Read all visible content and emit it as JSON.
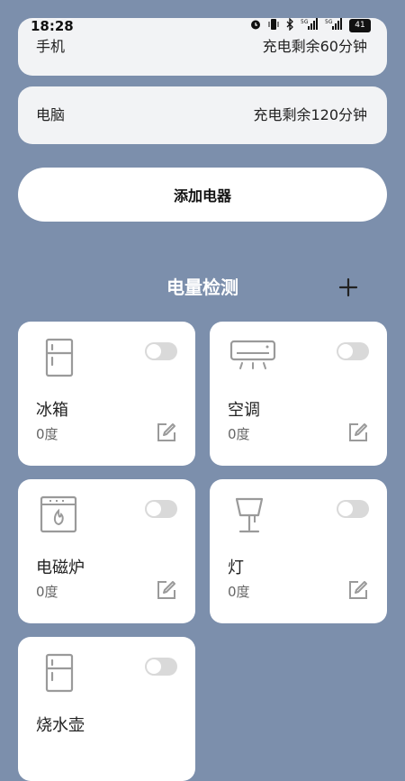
{
  "status_bar": {
    "time": "18:28",
    "icons": [
      "alarm-icon",
      "vibrate-icon",
      "bluetooth-icon",
      "signal-5g-icon",
      "signal-5g-icon-2",
      "battery-icon"
    ],
    "battery_level": "41"
  },
  "devices": [
    {
      "name": "手机",
      "value": "充电剩余60分钟"
    },
    {
      "name": "电脑",
      "value": "充电剩余120分钟"
    }
  ],
  "add_button_label": "添加电器",
  "section": {
    "title": "电量检测"
  },
  "appliances": [
    {
      "name": "冰箱",
      "value": "0度",
      "icon": "fridge-icon",
      "on": false
    },
    {
      "name": "空调",
      "value": "0度",
      "icon": "air-conditioner-icon",
      "on": false
    },
    {
      "name": "电磁炉",
      "value": "0度",
      "icon": "induction-cooker-icon",
      "on": false
    },
    {
      "name": "灯",
      "value": "0度",
      "icon": "lamp-icon",
      "on": false
    },
    {
      "name": "烧水壶",
      "value": "",
      "icon": "kettle-icon",
      "on": false
    }
  ],
  "colors": {
    "background": "#7c8fac",
    "card": "#ffffff",
    "toggle_off": "#d9d9d9",
    "icon": "#9a9a9a"
  }
}
